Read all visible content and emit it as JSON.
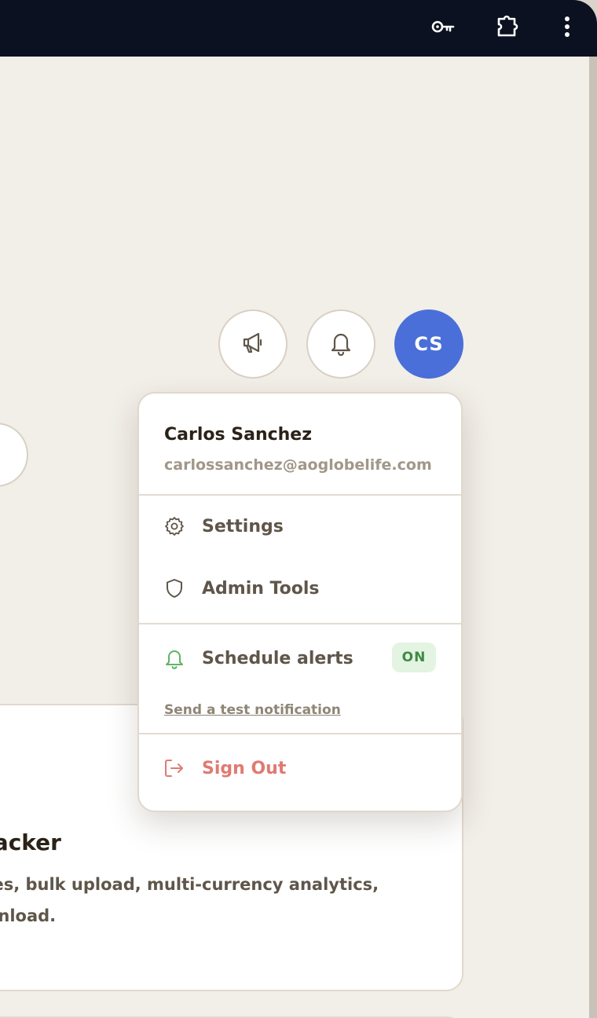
{
  "browser": {
    "icons": [
      "key-icon",
      "extension-puzzle-icon",
      "more-vert-icon"
    ]
  },
  "header_actions": {
    "announcements_icon": "megaphone-icon",
    "notifications_icon": "bell-icon",
    "avatar_initials": "CS",
    "avatar_color": "#4a6fd8"
  },
  "card": {
    "title": "racker",
    "description": "ces, bulk upload, multi-currency analytics, wnload."
  },
  "menu": {
    "user_name": "Carlos Sanchez",
    "user_email": "carlossanchez@aoglobelife.com",
    "items": [
      {
        "label": "Settings",
        "icon": "gear-icon"
      },
      {
        "label": "Admin Tools",
        "icon": "shield-icon"
      }
    ],
    "schedule_alerts": {
      "label": "Schedule alerts",
      "icon": "bell-icon",
      "status": "ON",
      "status_color": "#3f8a45"
    },
    "test_link": "Send a test notification",
    "sign_out": {
      "label": "Sign Out",
      "icon": "sign-out-icon",
      "color": "#e07a72"
    }
  }
}
